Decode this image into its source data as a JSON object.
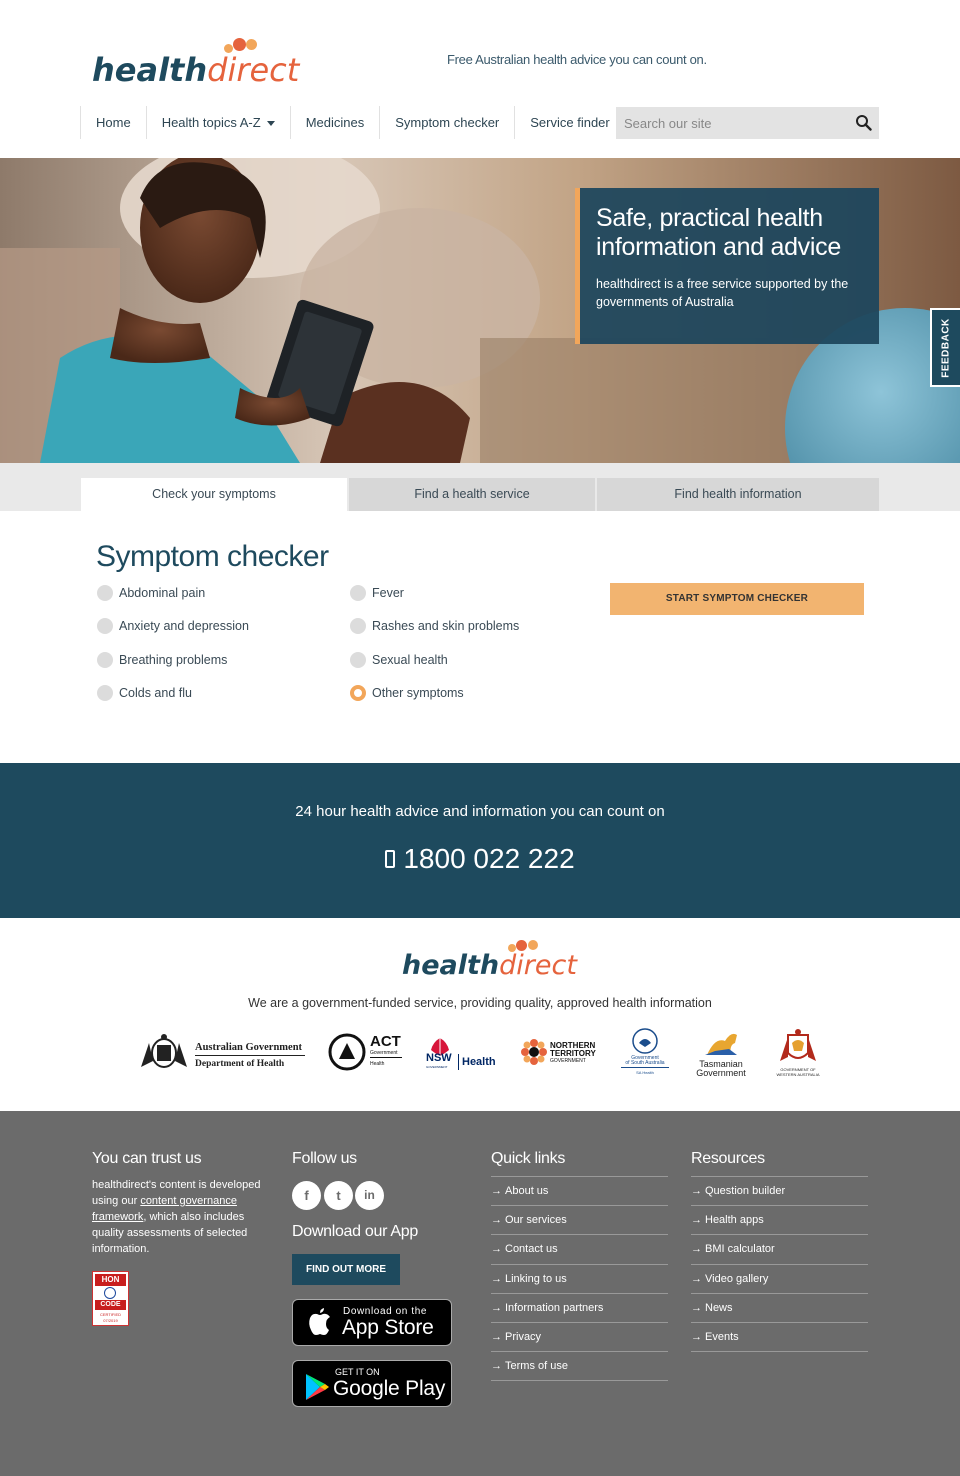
{
  "header": {
    "logo": {
      "part1": "health",
      "part2": "direct"
    },
    "tagline": "Free Australian health advice you can count on."
  },
  "nav": {
    "items": [
      {
        "label": "Home"
      },
      {
        "label": "Health topics A-Z"
      },
      {
        "label": "Medicines"
      },
      {
        "label": "Symptom checker"
      },
      {
        "label": "Service finder"
      }
    ],
    "search_placeholder": "Search our site"
  },
  "hero": {
    "title": "Safe, practical health information and advice",
    "subtitle": "healthdirect is a free service supported by the governments of Australia",
    "feedback_label": "FEEDBACK"
  },
  "tabs": [
    {
      "label": "Check your symptoms"
    },
    {
      "label": "Find a health service"
    },
    {
      "label": "Find health information"
    }
  ],
  "symptom_checker": {
    "title": "Symptom checker",
    "options": [
      {
        "label": "Abdominal pain"
      },
      {
        "label": "Anxiety and depression"
      },
      {
        "label": "Breathing problems"
      },
      {
        "label": "Colds and flu"
      },
      {
        "label": "Fever"
      },
      {
        "label": "Rashes and skin problems"
      },
      {
        "label": "Sexual health"
      },
      {
        "label": "Other symptoms"
      }
    ],
    "selected": "Other symptoms",
    "start_label": "START SYMPTOM CHECKER"
  },
  "banner": {
    "line": "24 hour health advice and information you can count on",
    "phone": "1800 022 222"
  },
  "gov": {
    "text": "We are a government-funded service, providing quality, approved health information",
    "logos": [
      {
        "line1": "Australian Government",
        "line2": "Department of Health"
      },
      {
        "line1": "ACT",
        "line2": "Government",
        "line3": "Health"
      },
      {
        "line1": "NSW",
        "line2": "GOVERNMENT",
        "line3": "Health"
      },
      {
        "line1": "NORTHERN",
        "line2": "TERRITORY",
        "line3": "GOVERNMENT"
      },
      {
        "line1": "Government",
        "line2": "of South Australia",
        "line3": "SA Health"
      },
      {
        "line1": "Tasmanian",
        "line2": "Government"
      },
      {
        "line1": "GOVERNMENT OF",
        "line2": "WESTERN AUSTRALIA"
      }
    ]
  },
  "footer": {
    "trust": {
      "heading": "You can trust us",
      "text_before": "healthdirect's content is developed using our ",
      "link": "content governance framework",
      "text_after": ", which also includes quality assessments of selected information.",
      "hon": {
        "line1": "HON",
        "line2": "CODE",
        "line3": "CERTIFIED",
        "line4": "07/2019"
      }
    },
    "follow": {
      "heading": "Follow us",
      "icons": [
        "facebook-icon",
        "twitter-icon",
        "linkedin-icon"
      ],
      "icon_glyphs": [
        "f",
        "t",
        "in"
      ]
    },
    "app": {
      "heading": "Download our App",
      "button": "FIND OUT MORE",
      "appstore_small": "Download on the",
      "appstore_big": "App Store",
      "googleplay_small": "GET IT ON",
      "googleplay_big": "Google Play"
    },
    "quick_links": {
      "heading": "Quick links",
      "items": [
        "About us",
        "Our services",
        "Contact us",
        "Linking to us",
        "Information partners",
        "Privacy",
        "Terms of use"
      ]
    },
    "resources": {
      "heading": "Resources",
      "items": [
        "Question builder",
        "Health apps",
        "BMI calculator",
        "Video gallery",
        "News",
        "Events"
      ]
    }
  },
  "colors": {
    "brand_dark": "#1e4a5e",
    "brand_accent": "#e5633d",
    "button_orange": "#f2b470",
    "footer_gray": "#6b6b6b"
  }
}
